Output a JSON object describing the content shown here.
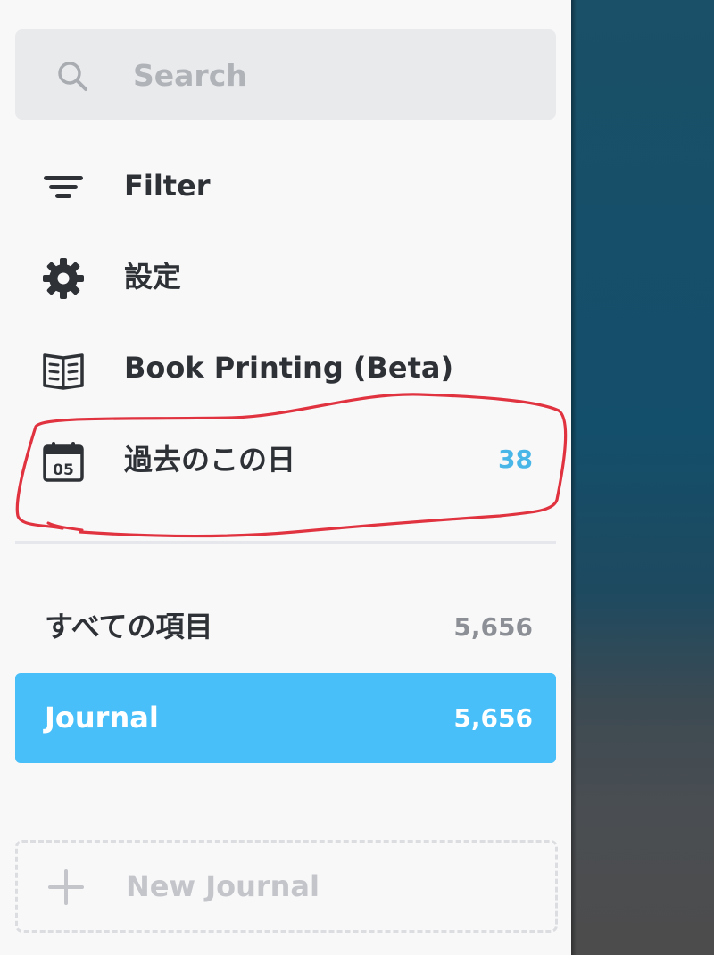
{
  "search": {
    "placeholder": "Search"
  },
  "menu": {
    "filter": {
      "label": "Filter",
      "icon": "filter-icon"
    },
    "settings": {
      "label": "設定",
      "icon": "gear-icon"
    },
    "book_printing": {
      "label": "Book Printing (Beta)",
      "icon": "book-icon"
    },
    "on_this_day": {
      "label": "過去のこの日",
      "count": "38",
      "icon": "calendar-icon",
      "calendar_day": "05"
    }
  },
  "journals": {
    "all_entries": {
      "label": "すべての項目",
      "count": "5,656"
    },
    "items": [
      {
        "label": "Journal",
        "count": "5,656",
        "selected": true
      }
    ],
    "new_journal": {
      "label": "New Journal",
      "icon": "plus-icon"
    }
  },
  "colors": {
    "accent": "#48bff8",
    "count_blue": "#49b6e8",
    "annotation_red": "#e0323f"
  }
}
